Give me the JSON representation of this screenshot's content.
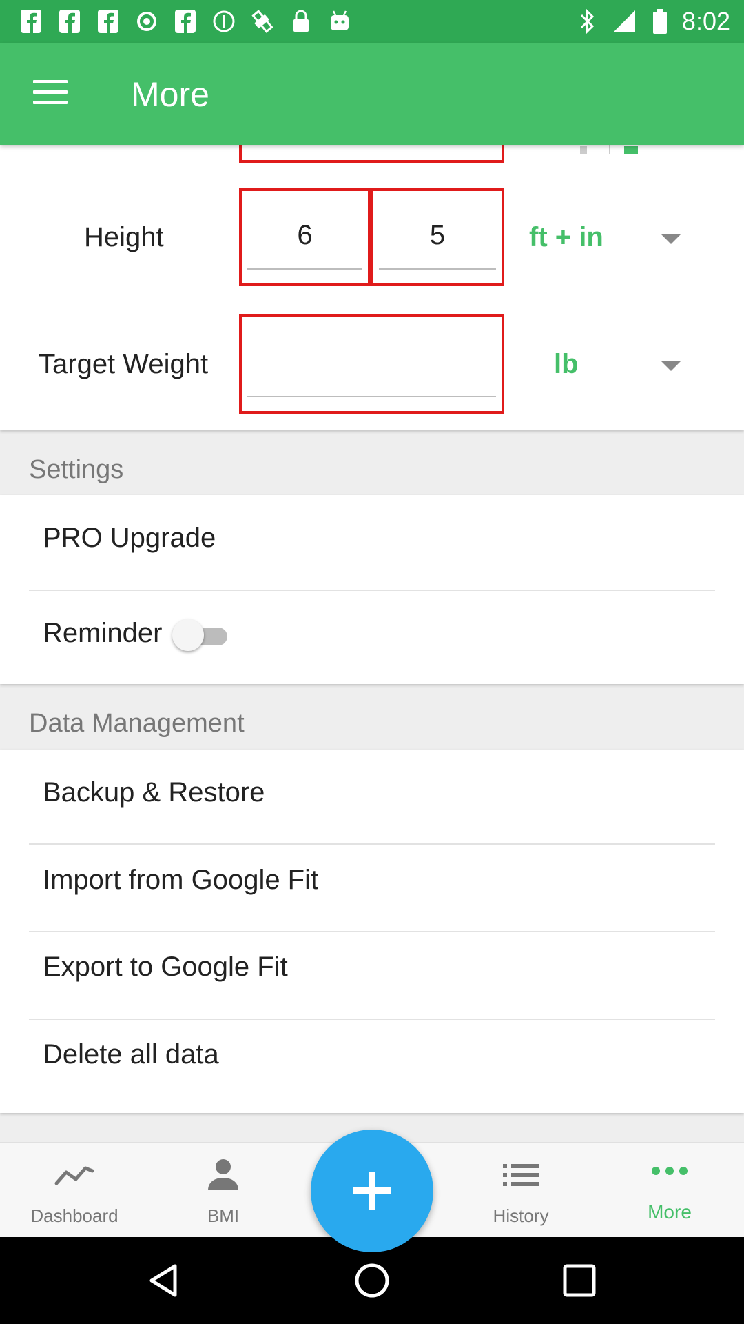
{
  "status_bar": {
    "time": "8:02",
    "icons": [
      "facebook-icon",
      "facebook-icon",
      "facebook-icon",
      "record-icon",
      "facebook-icon",
      "info-icon",
      "fake-gps-icon",
      "lock-icon",
      "android-icon",
      "bluetooth-icon",
      "signal-icon",
      "battery-icon"
    ]
  },
  "app_bar": {
    "title": "More"
  },
  "profile": {
    "height": {
      "label": "Height",
      "feet": "6",
      "inches": "5",
      "unit": "ft + in"
    },
    "target_weight": {
      "label": "Target Weight",
      "value": "",
      "unit": "lb"
    }
  },
  "settings": {
    "header": "Settings",
    "items": [
      {
        "label": "PRO Upgrade"
      },
      {
        "label": "Reminder",
        "toggle_on": false
      }
    ]
  },
  "data_management": {
    "header": "Data Management",
    "items": [
      {
        "label": "Backup & Restore"
      },
      {
        "label": "Import from Google Fit"
      },
      {
        "label": "Export to Google Fit"
      },
      {
        "label": "Delete all data"
      }
    ]
  },
  "bottom_nav": {
    "items": [
      {
        "label": "Dashboard",
        "icon": "trend-line-icon"
      },
      {
        "label": "BMI",
        "icon": "person-icon"
      },
      {
        "label": "History",
        "icon": "list-icon"
      },
      {
        "label": "More",
        "icon": "more-dots-icon",
        "active": true
      }
    ],
    "fab_icon": "plus-icon"
  },
  "colors": {
    "accent": "#45bf69",
    "status_bar": "#2fa954",
    "fab": "#29a9ee",
    "highlight_border": "#e01b1b"
  }
}
